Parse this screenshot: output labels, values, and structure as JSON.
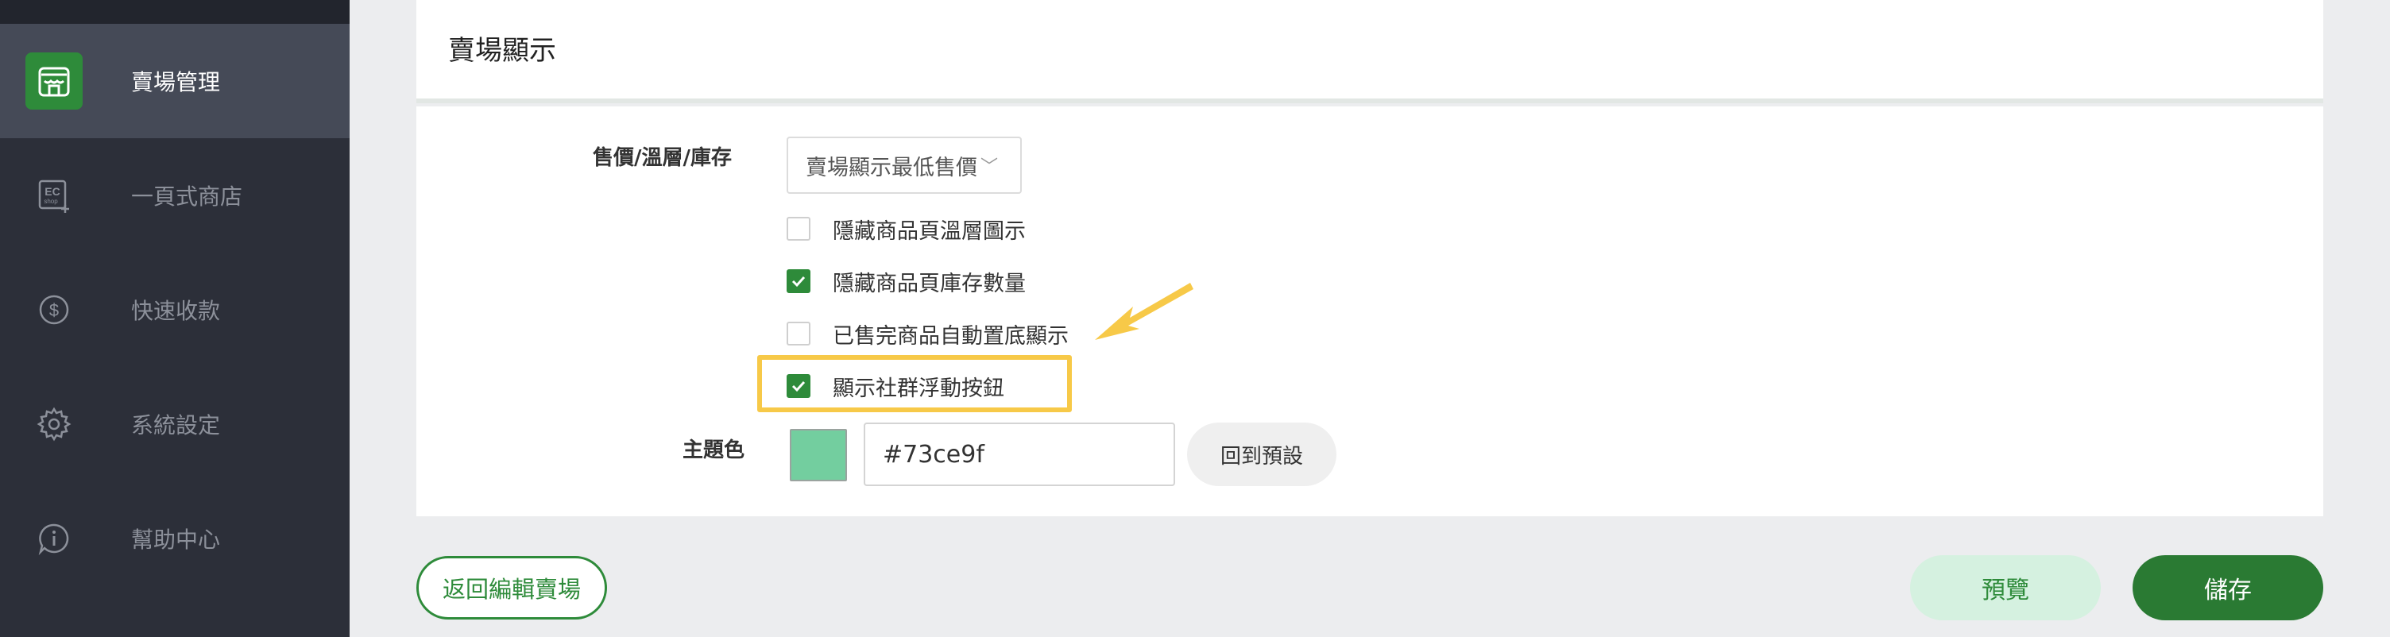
{
  "sidebar": {
    "items": [
      {
        "label": "賣場管理",
        "icon": "storefront-icon",
        "active": true
      },
      {
        "label": "一頁式商店",
        "icon": "ec-shop-icon",
        "active": false
      },
      {
        "label": "快速收款",
        "icon": "dollar-icon",
        "active": false
      },
      {
        "label": "系統設定",
        "icon": "gear-icon",
        "active": false
      },
      {
        "label": "幫助中心",
        "icon": "info-icon",
        "active": false
      }
    ],
    "ec_icon_text": "EC",
    "ec_icon_sub": "shop"
  },
  "header": {
    "title": "賣場顯示"
  },
  "settings": {
    "price_label": "售價/溫層/庫存",
    "price_select": {
      "value": "賣場顯示最低售價",
      "chevron": "﹀"
    },
    "options": [
      {
        "label": "隱藏商品頁溫層圖示",
        "checked": false
      },
      {
        "label": "隱藏商品頁庫存數量",
        "checked": true
      },
      {
        "label": "已售完商品自動置底顯示",
        "checked": false
      },
      {
        "label": "顯示社群浮動按鈕",
        "checked": true
      }
    ],
    "theme_label": "主題色",
    "theme_color": "#73ce9f",
    "theme_hex_value": "#73ce9f",
    "reset_label": "回到預設"
  },
  "footer": {
    "back_label": "返回編輯賣場",
    "preview_label": "預覽",
    "save_label": "儲存"
  },
  "colors": {
    "sidebar_bg": "#2c2f39",
    "accent_green": "#2e8b3a",
    "highlight_yellow": "#f7c948",
    "preview_bg": "#d5f1e0"
  }
}
